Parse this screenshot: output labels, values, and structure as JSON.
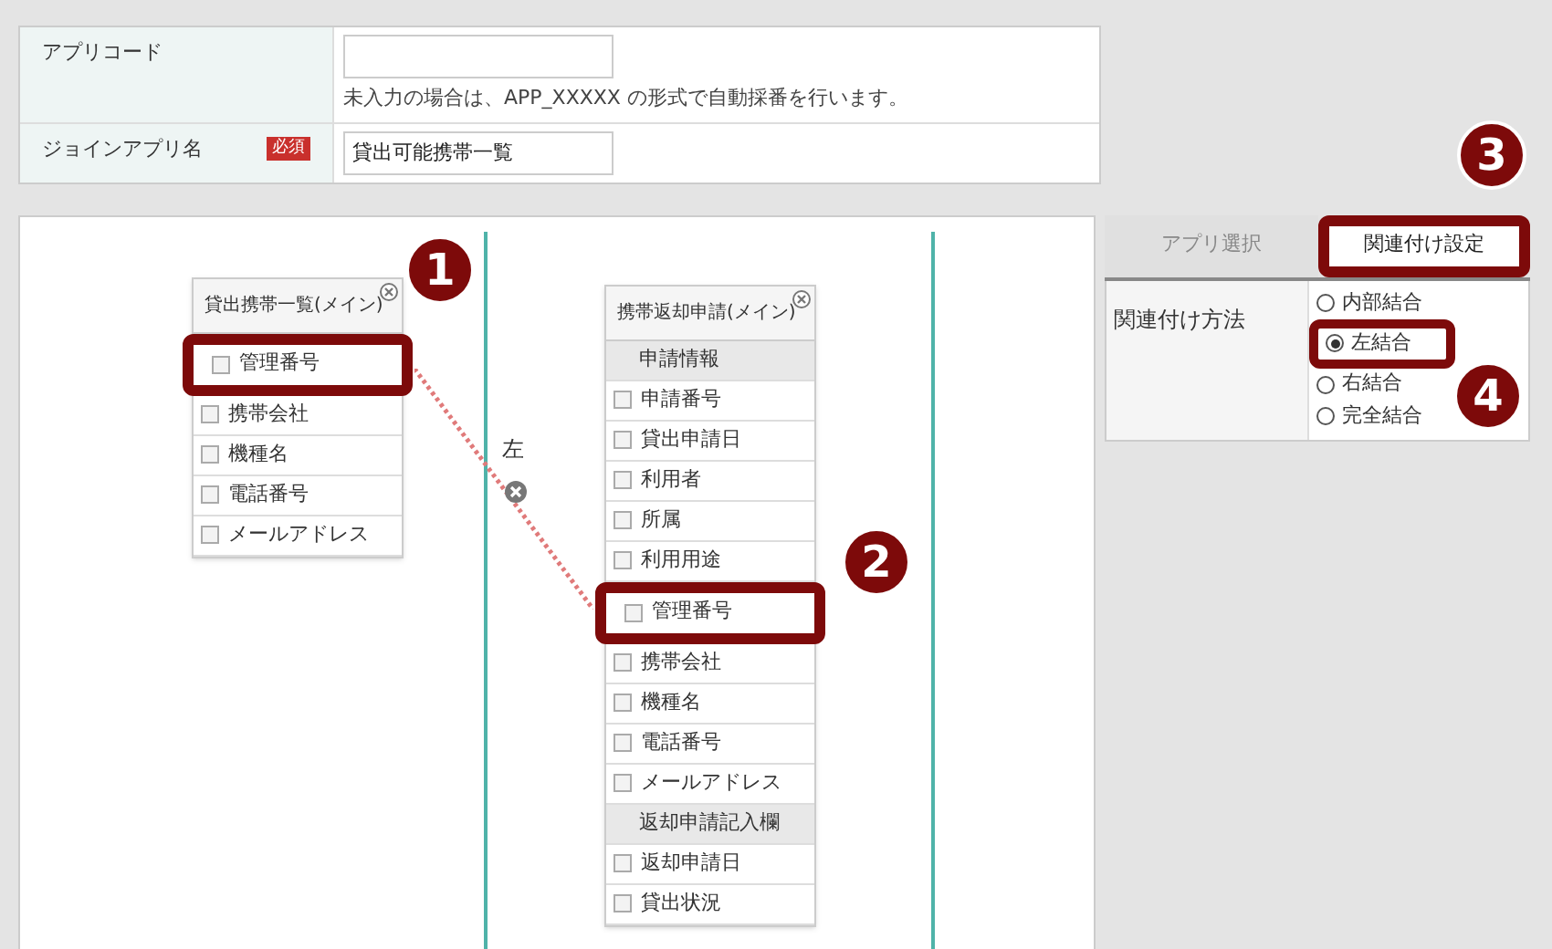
{
  "form": {
    "rows": [
      {
        "label": "アプリコード",
        "value": "",
        "note": "未入力の場合は、APP_XXXXX の形式で自動採番を行います。"
      },
      {
        "label": "ジョインアプリ名",
        "required_badge": "必須",
        "value": "貸出可能携帯一覧"
      }
    ]
  },
  "canvas": {
    "join_label": "左",
    "tables": [
      {
        "title": "貸出携帯一覧(メイン)",
        "badge": "1",
        "rows": [
          {
            "kind": "field",
            "label": "管理番号",
            "highlighted": true
          },
          {
            "kind": "field",
            "label": "携帯会社",
            "highlighted": false
          },
          {
            "kind": "field",
            "label": "機種名",
            "highlighted": false
          },
          {
            "kind": "field",
            "label": "電話番号",
            "highlighted": false
          },
          {
            "kind": "field",
            "label": "メールアドレス",
            "highlighted": false
          }
        ]
      },
      {
        "title": "携帯返却申請(メイン)",
        "badge": "2",
        "rows": [
          {
            "kind": "section",
            "label": "申請情報",
            "highlighted": false
          },
          {
            "kind": "field",
            "label": "申請番号",
            "highlighted": false
          },
          {
            "kind": "field",
            "label": "貸出申請日",
            "highlighted": false
          },
          {
            "kind": "field",
            "label": "利用者",
            "highlighted": false
          },
          {
            "kind": "field",
            "label": "所属",
            "highlighted": false
          },
          {
            "kind": "field",
            "label": "利用用途",
            "highlighted": false
          },
          {
            "kind": "field",
            "label": "管理番号",
            "highlighted": true
          },
          {
            "kind": "field",
            "label": "携帯会社",
            "highlighted": false
          },
          {
            "kind": "field",
            "label": "機種名",
            "highlighted": false
          },
          {
            "kind": "field",
            "label": "電話番号",
            "highlighted": false
          },
          {
            "kind": "field",
            "label": "メールアドレス",
            "highlighted": false
          },
          {
            "kind": "section",
            "label": "返却申請記入欄",
            "highlighted": false
          },
          {
            "kind": "field",
            "label": "返却申請日",
            "highlighted": false
          },
          {
            "kind": "field",
            "label": "貸出状況",
            "highlighted": false
          }
        ]
      }
    ]
  },
  "side_panel": {
    "tabs": [
      {
        "label": "アプリ選択",
        "selected": false,
        "highlighted": false
      },
      {
        "label": "関連付け設定",
        "selected": true,
        "highlighted": true
      }
    ],
    "tab_badge": "3",
    "method_label": "関連付け方法",
    "radio_badge": "4",
    "options": [
      {
        "label": "内部結合",
        "selected": false,
        "highlighted": false
      },
      {
        "label": "左結合",
        "selected": true,
        "highlighted": true
      },
      {
        "label": "右結合",
        "selected": false,
        "highlighted": false
      },
      {
        "label": "完全結合",
        "selected": false,
        "highlighted": false
      }
    ]
  }
}
